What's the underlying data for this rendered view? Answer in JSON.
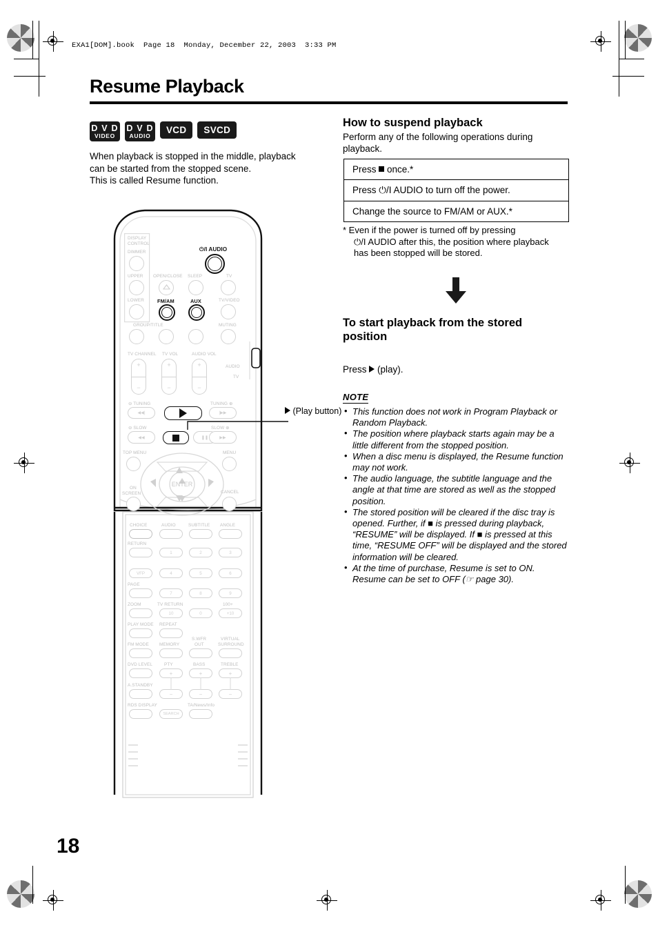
{
  "header": {
    "file_line": "EXA1[DOM].book  Page 18  Monday, December 22, 2003  3:33 PM"
  },
  "page": {
    "title": "Resume Playback",
    "number": "18"
  },
  "left_column": {
    "badges": [
      {
        "line1": "D V D",
        "line2": "VIDEO",
        "type": "two-line"
      },
      {
        "line1": "D V D",
        "line2": "AUDIO",
        "type": "two-line"
      },
      {
        "line1": "VCD",
        "type": "one-line"
      },
      {
        "line1": "SVCD",
        "type": "one-line"
      }
    ],
    "intro_line1": "When playback is stopped in the middle, playback",
    "intro_line2": "can be started from the stopped scene.",
    "intro_line3": "This is called Resume function.",
    "callout": "(Play button)"
  },
  "right_column": {
    "section1_heading": "How to suspend playback",
    "section1_intro_line1": "Perform any of the following operations during",
    "section1_intro_line2": "playback.",
    "operations": [
      {
        "before": "Press ",
        "glyph": "stop-square",
        "after": " once.*"
      },
      {
        "before": "Press ",
        "glyph": "power-audio",
        "after": " AUDIO to turn off the power."
      },
      {
        "before": "Change the source to FM/AM or AUX.*",
        "glyph": "none",
        "after": ""
      }
    ],
    "footnote_line1": "*   Even if the power is turned off by pressing",
    "footnote_line2": "⏻/I AUDIO after this, the position where playback",
    "footnote_line3": "has been stopped will be stored.",
    "section2_heading_line1": "To start playback from the stored",
    "section2_heading_line2": "position",
    "press_play_before": "Press ",
    "press_play_after": " (play).",
    "note_heading": "NOTE",
    "notes": [
      "This function does not work in Program Playback or Random Playback.",
      "The position where playback starts again may be a little different from the stopped position.",
      "When a disc menu is displayed, the Resume function may not work.",
      "The audio language, the subtitle language and the angle at that time are stored as well as the stopped position.",
      "The stored position will be cleared if the disc tray is opened. Further, if ■ is pressed during playback, “RESUME” will be displayed. If ■ is pressed at this time, “RESUME OFF” will be displayed and the stored information will be cleared.",
      "At the time of purchase, Resume is set to ON. Resume can be set to OFF (☞ page 30)."
    ]
  },
  "remote": {
    "power_audio_label": "⏻/I AUDIO",
    "labels": {
      "display_control_1": "DISPLAY",
      "display_control_2": "CONTROL",
      "dimmer": "DIMMER",
      "upper": "UPPER",
      "lower": "LOWER",
      "open_close": "OPEN/CLOSE",
      "sleep": "SLEEP",
      "tv": "TV",
      "fm_am": "FM/AM",
      "aux": "AUX",
      "tv_video": "TV/VIDEO",
      "group_title": "GROUP/TITLE",
      "muting": "MUTING",
      "tv_channel": "TV CHANNEL",
      "tv_vol": "TV VOL",
      "audio_vol": "AUDIO VOL",
      "audio_switch": "AUDIO",
      "tv_switch": "TV",
      "tuning_minus": "⊖ TUNING",
      "tuning_plus": "TUNING ⊕",
      "slow_minus": "⊖ SLOW",
      "slow_plus": "SLOW ⊕",
      "top_menu": "TOP MENU",
      "menu": "MENU",
      "on_screen_1": "ON",
      "on_screen_2": "SCREEN",
      "cancel": "CANCEL",
      "enter": "ENTER",
      "choice": "CHOICE",
      "audio": "AUDIO",
      "subtitle": "SUBTITLE",
      "angle": "ANGLE",
      "return": "RETURN",
      "vfp": "VFP",
      "page": "PAGE",
      "zoom": "ZOOM",
      "tv_return": "TV RETURN",
      "hundred_plus": "100+",
      "play_mode": "PLAY MODE",
      "repeat": "REPEAT",
      "fm_mode": "FM MODE",
      "memory": "MEMORY",
      "swfr_out_1": "S.WFR",
      "swfr_out_2": "OUT",
      "virtual_1": "VIRTUAL",
      "virtual_2": "SURROUND",
      "dvd_level": "DVD LEVEL",
      "pty": "PTY",
      "bass": "BASS",
      "treble": "TREBLE",
      "a_standby": "A.STANDBY",
      "rds_display": "RDS DISPLAY",
      "ta_news_info": "TA/News/Info",
      "search": "SEARCH"
    },
    "numeric_keys": [
      "1",
      "2",
      "3",
      "4",
      "5",
      "6",
      "7",
      "8",
      "9",
      "10",
      "0",
      "+10"
    ]
  }
}
